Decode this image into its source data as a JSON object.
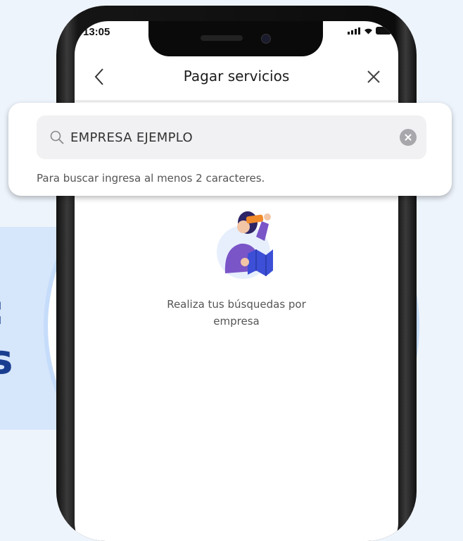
{
  "status_bar": {
    "time": "13:05"
  },
  "nav": {
    "title": "Pagar servicios"
  },
  "search": {
    "value": "EMPRESA EJEMPLO",
    "hint": "Para buscar ingresa al menos 2 caracteres."
  },
  "empty_state": {
    "line1": "Realiza tus búsquedas por",
    "line2": "empresa"
  },
  "colors": {
    "page_bg": "#eef4fc",
    "panel": "#d6e6fb",
    "accent_text": "#1a3e8f",
    "circle_ring": "#c5dcfa",
    "illustration_purple": "#7a55c7",
    "illustration_orange": "#f08a2b"
  }
}
